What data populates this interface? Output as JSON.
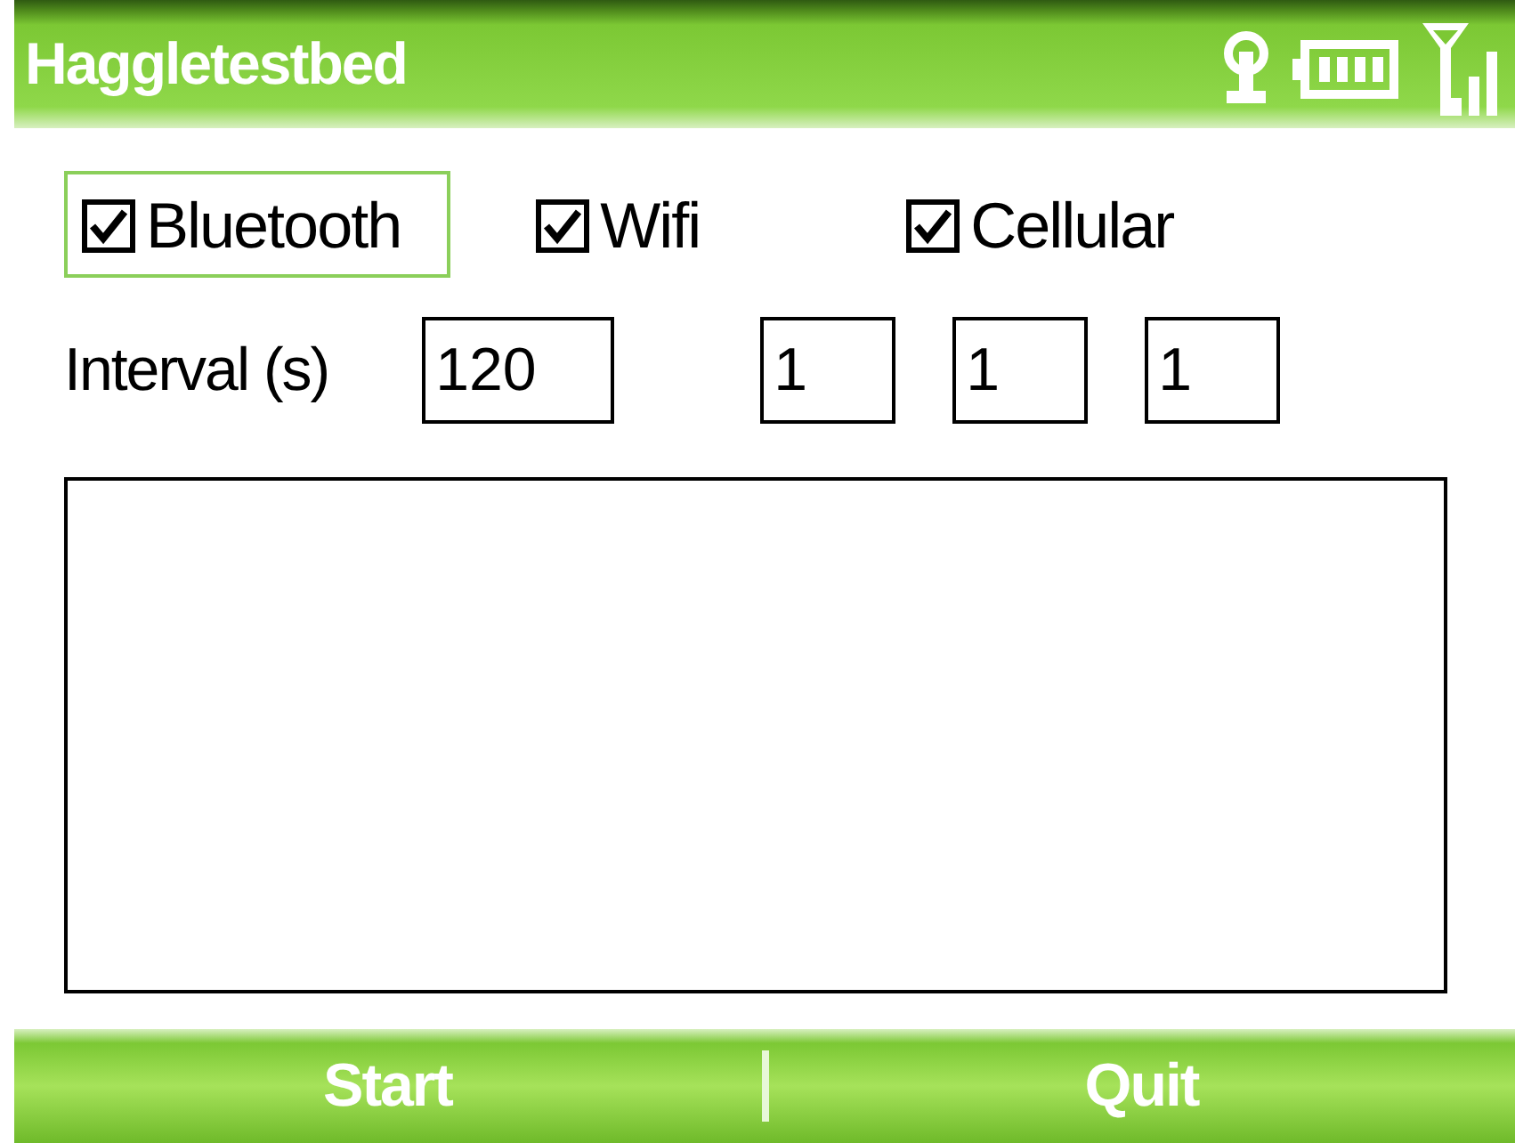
{
  "title_bar": {
    "title": "Haggletestbed"
  },
  "options": [
    {
      "label": "Bluetooth",
      "checked": true,
      "focused": true
    },
    {
      "label": "Wifi",
      "checked": true,
      "focused": false
    },
    {
      "label": "Cellular",
      "checked": true,
      "focused": false
    }
  ],
  "interval": {
    "label": "Interval (s)",
    "fields": [
      {
        "value": "120"
      },
      {
        "value": "1"
      },
      {
        "value": "1"
      },
      {
        "value": "1"
      }
    ]
  },
  "soft_keys": [
    {
      "label": "Start"
    },
    {
      "label": "Quit"
    }
  ]
}
